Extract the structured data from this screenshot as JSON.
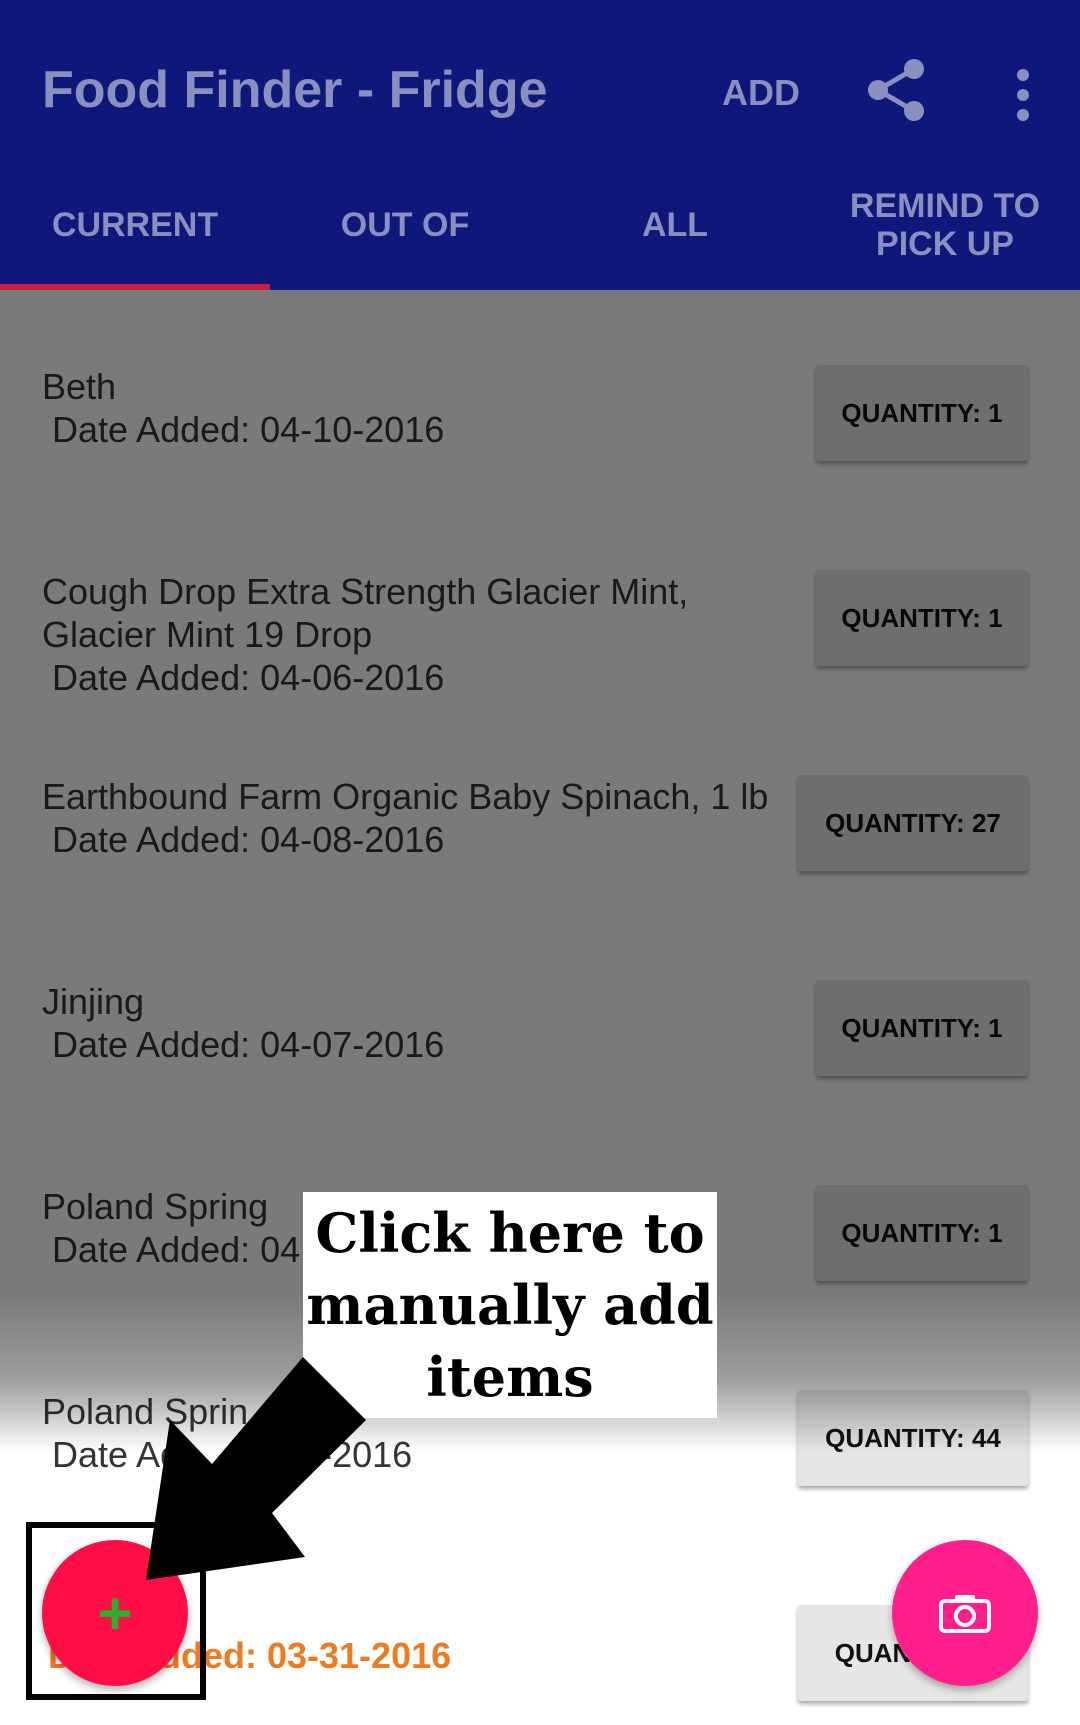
{
  "appbar": {
    "title": "Food Finder - Fridge",
    "add_label": "ADD",
    "share_icon": "share-icon",
    "more_icon": "more-vert-icon"
  },
  "tabs": [
    {
      "label": "CURRENT",
      "selected": true
    },
    {
      "label": "OUT OF",
      "selected": false
    },
    {
      "label": "ALL",
      "selected": false
    },
    {
      "label": "REMIND TO PICK UP",
      "selected": false
    }
  ],
  "items": [
    {
      "name": "Beth",
      "date": "Date Added: 04-10-2016",
      "quantity": "QUANTITY: 1"
    },
    {
      "name": "Cough Drop Extra Strength Glacier Mint, Glacier Mint 19 Drop",
      "date": "Date Added: 04-06-2016",
      "quantity": "QUANTITY: 1"
    },
    {
      "name": "Earthbound Farm Organic Baby Spinach, 1 lb",
      "date": "Date Added: 04-08-2016",
      "quantity": "QUANTITY: 27"
    },
    {
      "name": "Jinjing",
      "date": "Date Added: 04-07-2016",
      "quantity": "QUANTITY: 1"
    },
    {
      "name": "Poland Spring",
      "date": "Date Added: 04",
      "quantity": "QUANTITY: 1"
    },
    {
      "name": "Poland Sprin",
      "date": "Date Ad",
      "date_tail": "4-2016",
      "quantity": "QUANTITY: 44"
    }
  ],
  "last_row": {
    "date_visible": "dded: 03-31-2016",
    "date_prefix": "D",
    "quantity_visible": "QUAN"
  },
  "annotation": {
    "callout_text": "Click here to manually add items"
  },
  "fab": {
    "add_symbol": "+",
    "camera_icon": "camera-icon"
  },
  "colors": {
    "appbar": "#0f177a",
    "tab_indicator": "#c8203a",
    "fab_add": "#ff0d46",
    "fab_camera": "#ff1e8c",
    "date_highlight": "#f07a1e"
  }
}
